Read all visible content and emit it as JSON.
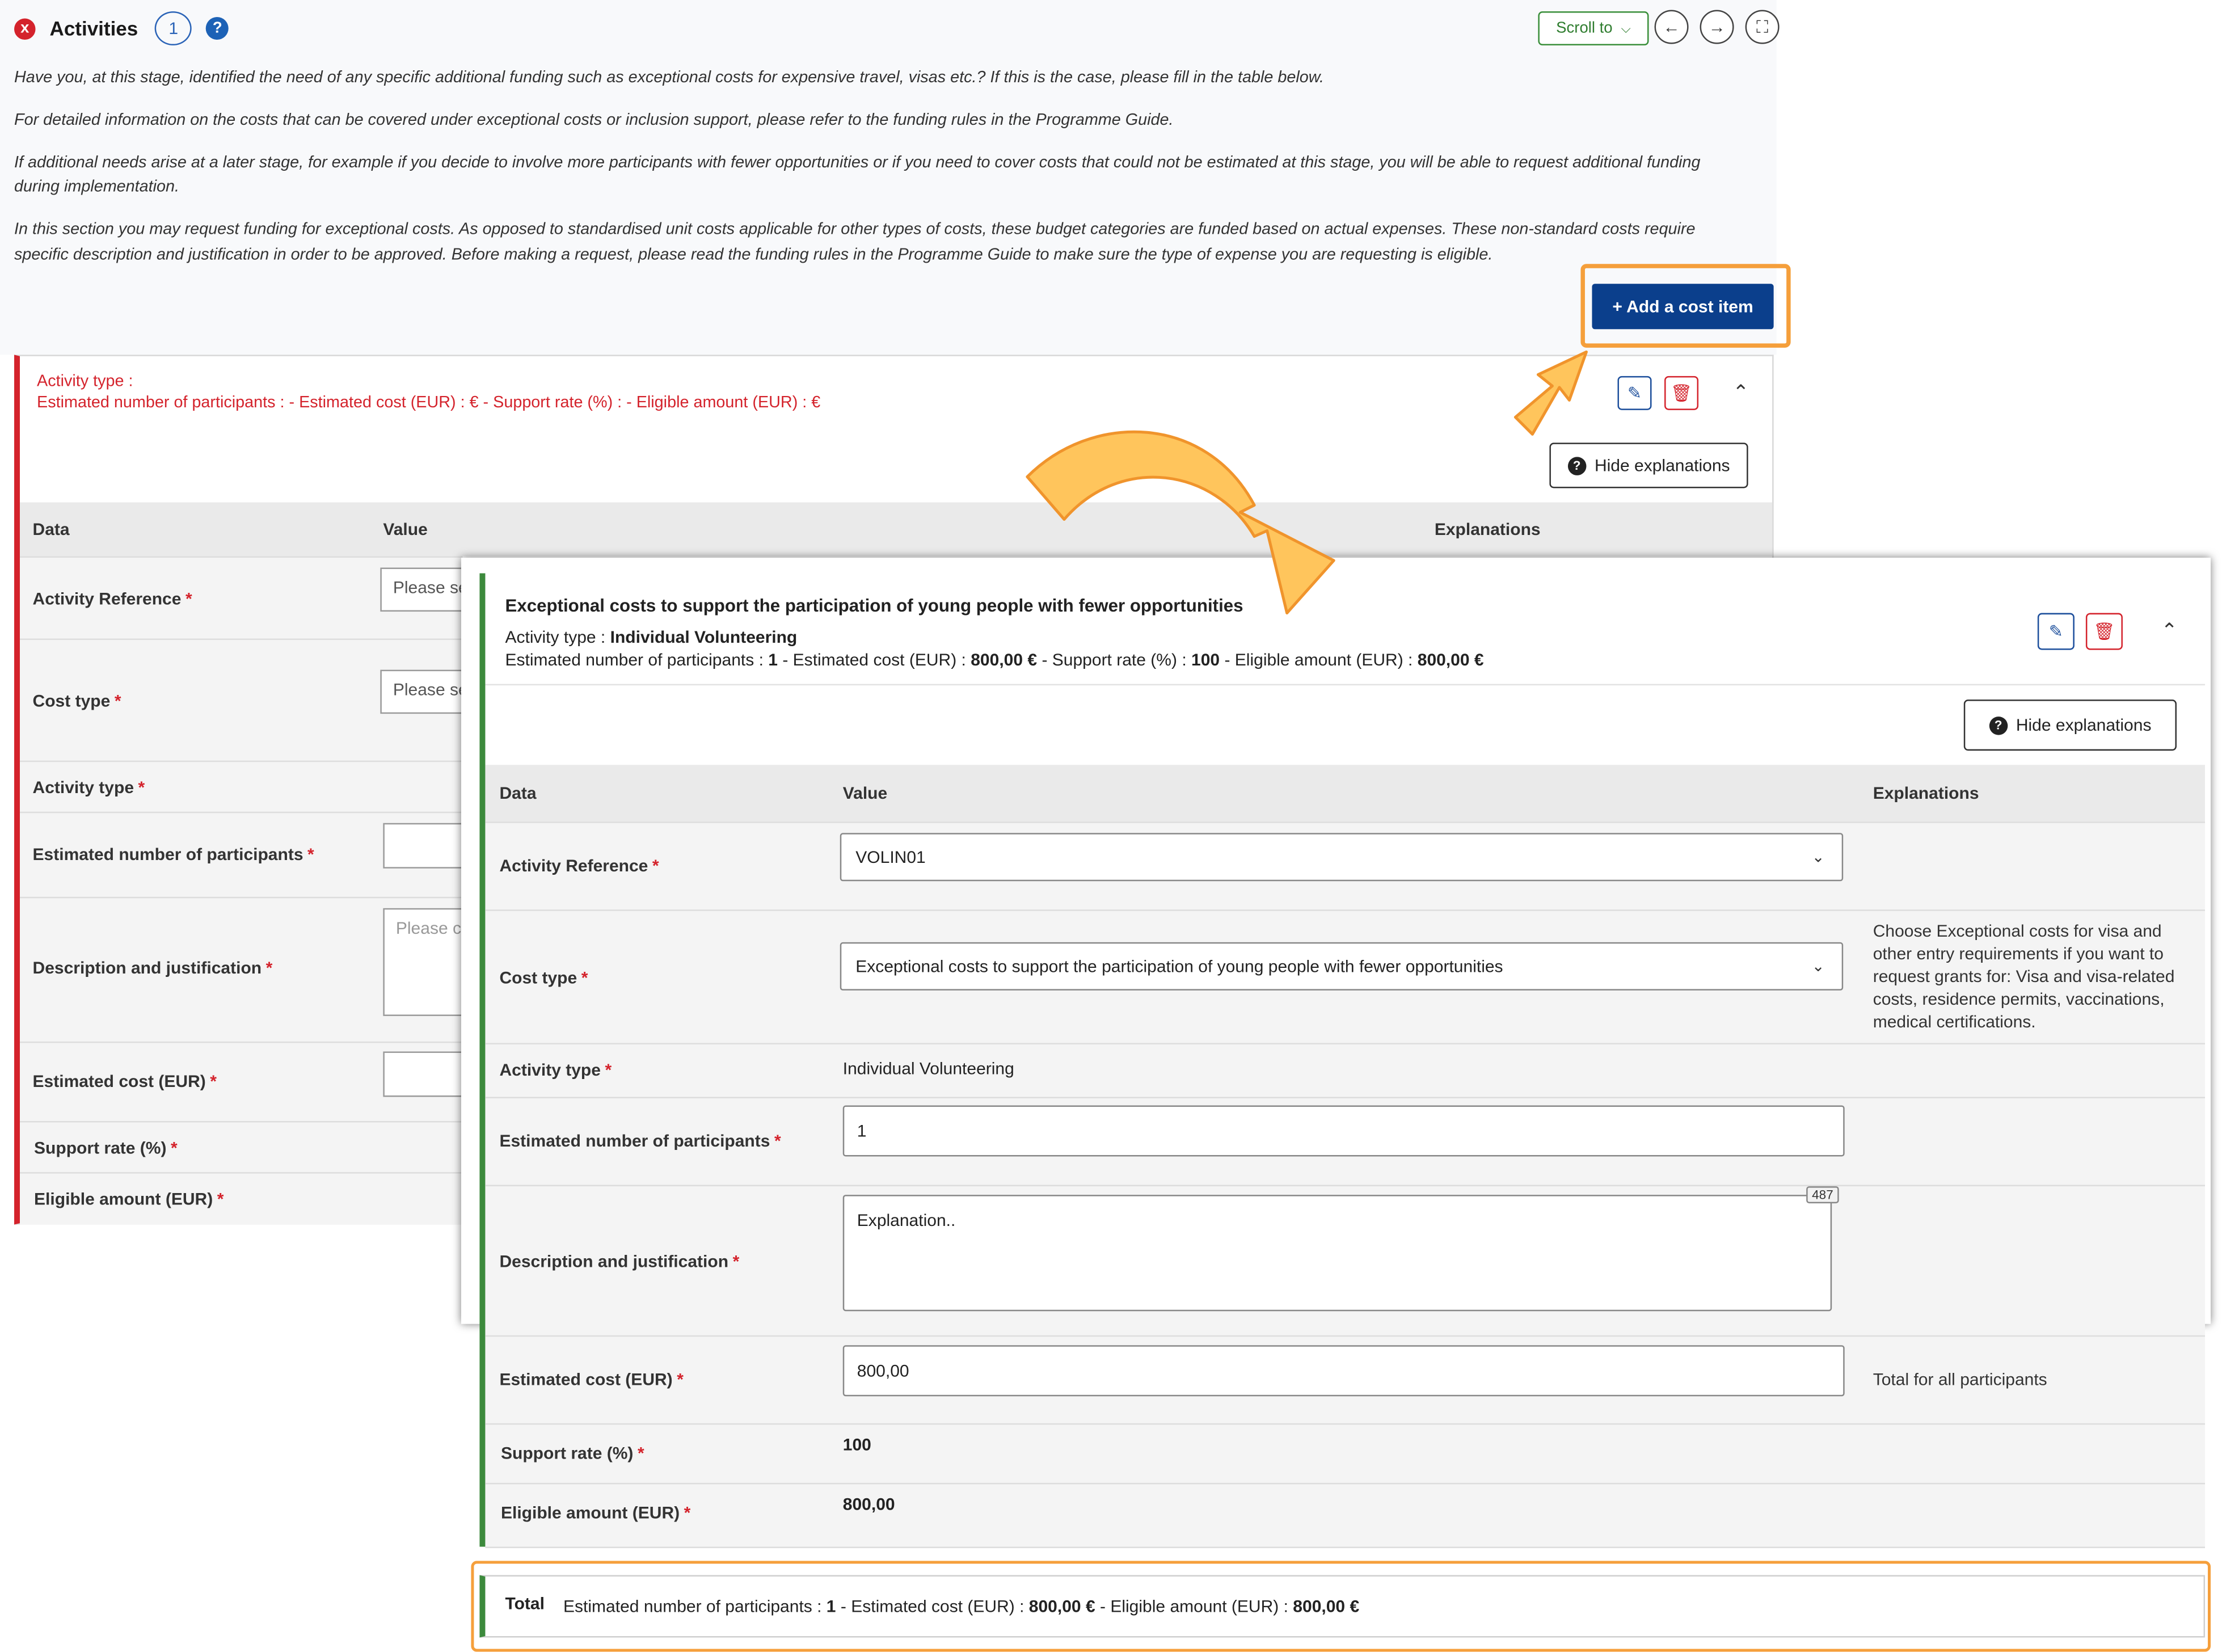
{
  "header": {
    "error_icon": "x",
    "title": "Activities",
    "count": "1",
    "help_icon": "?",
    "scroll_to": "Scroll to",
    "nav_prev_icon": "←",
    "nav_next_icon": "→",
    "expand_icon": "⛶"
  },
  "intro": {
    "p1": "Have you, at this stage, identified the need of any specific additional funding such as exceptional costs for expensive travel, visas etc.? If this is the case, please fill in the table below.",
    "p2": "For detailed information on the costs that can be covered under exceptional costs or inclusion support, please refer to the funding rules in the Programme Guide.",
    "p3a": "If additional needs arise at a later stage, for example if you decide to involve more participants with fewer opportunities or if you need to cover costs that could not be estimated at this stage, you will be able to request additional funding",
    "p3b": "during implementation.",
    "p4a": "In this section you may request funding for exceptional costs. As opposed to standardised unit costs applicable for other types of costs, these budget categories are funded based on actual expenses. These non-standard costs require",
    "p4b": "specific description and justification in order to be approved. Before making a request, please read the funding rules in the Programme Guide to make sure the type of expense you are requesting is eligible.",
    "add_button": "+ Add a cost item"
  },
  "back_card": {
    "line1": "Activity type :",
    "line2": "Estimated number of participants :  - Estimated cost (EUR) : € - Support rate (%) :  - Eligible amount (EUR) : €",
    "hide_explanations": "Hide explanations",
    "col_data": "Data",
    "col_value": "Value",
    "col_explanations": "Explanations",
    "activity_reference_label": "Activity Reference",
    "activity_reference_placeholder": "Please se",
    "cost_type_label": "Cost type",
    "cost_type_placeholder": "Please se",
    "activity_type_label": "Activity type",
    "participants_label": "Estimated number of participants",
    "description_label": "Description and justification",
    "description_placeholder": "Please c",
    "estimated_cost_label": "Estimated cost (EUR)",
    "support_rate_label": "Support rate (%)",
    "eligible_amount_label": "Eligible amount (EUR)",
    "required_mark": "*"
  },
  "front_card": {
    "title": "Exceptional costs to support the participation of young people with fewer opportunities",
    "activity_type_prefix": "Activity type : ",
    "activity_type_value": "Individual Volunteering",
    "summary_participants_label": "Estimated number of participants : ",
    "summary_participants": "1",
    "summary_cost_label": " - Estimated cost (EUR) : ",
    "summary_cost": "800,00 €",
    "summary_rate_label": " - Support rate (%) : ",
    "summary_rate": "100",
    "summary_eligible_label": " - Eligible amount (EUR) : ",
    "summary_eligible": "800,00 €",
    "hide_explanations": "Hide explanations",
    "col_data": "Data",
    "col_value": "Value",
    "col_explanations": "Explanations",
    "activity_reference_label": "Activity Reference",
    "activity_reference_value": "VOLIN01",
    "cost_type_label": "Cost type",
    "cost_type_value": "Exceptional costs to support the participation of young people with fewer opportunities",
    "cost_type_explanation": "Choose Exceptional costs for visa and other entry requirements if you want to request grants for: Visa and visa-related costs, residence permits, vaccinations, medical certifications.",
    "activity_type_label": "Activity type",
    "activity_type_field_value": "Individual Volunteering",
    "participants_label": "Estimated number of participants",
    "participants_value": "1",
    "description_label": "Description and justification",
    "description_value": "Explanation..",
    "char_counter": "487",
    "estimated_cost_label": "Estimated cost (EUR)",
    "estimated_cost_value": "800,00",
    "estimated_cost_explanation": "Total for all participants",
    "support_rate_label": "Support rate (%)",
    "support_rate_value": "100",
    "eligible_amount_label": "Eligible amount (EUR)",
    "eligible_amount_value": "800,00",
    "required_mark": "*"
  },
  "total": {
    "label": "Total",
    "participants_label": "Estimated number of participants : ",
    "participants": "1",
    "cost_label": " - Estimated cost (EUR) : ",
    "cost": "800,00 €",
    "eligible_label": " - Eligible amount (EUR) : ",
    "eligible": "800,00 €"
  },
  "icons": {
    "edit": "pencil-icon",
    "delete": "trash-icon",
    "collapse": "chevron-up-icon",
    "dropdown": "chevron-down-icon"
  },
  "colors": {
    "primary_button": "#0b3f8c",
    "error_red": "#d4232c",
    "success_green": "#3c8a3c",
    "highlight_orange": "#f59f3b"
  }
}
